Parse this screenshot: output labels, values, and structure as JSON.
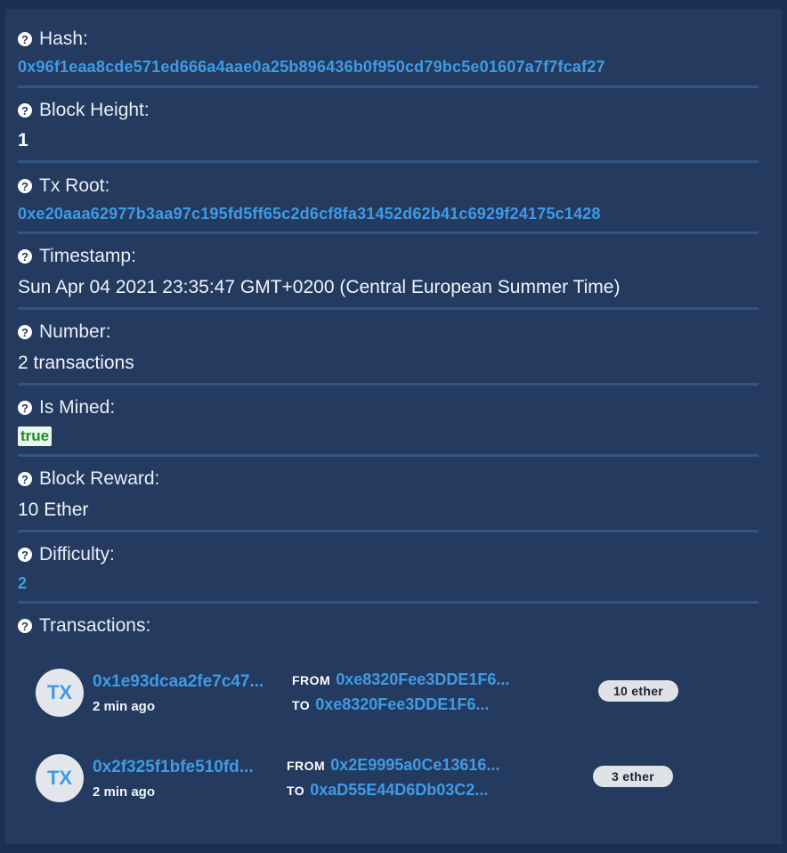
{
  "fields": {
    "hash": {
      "label": "Hash:",
      "value": "0x96f1eaa8cde571ed666a4aae0a25b896436b0f950cd79bc5e01607a7f7fcaf27"
    },
    "block_height": {
      "label": "Block Height:",
      "value": "1"
    },
    "tx_root": {
      "label": "Tx Root:",
      "value": "0xe20aaa62977b3aa97c195fd5ff65c2d6cf8fa31452d62b41c6929f24175c1428"
    },
    "timestamp": {
      "label": "Timestamp:",
      "value": "Sun Apr 04 2021 23:35:47 GMT+0200 (Central European Summer Time)"
    },
    "number": {
      "label": "Number:",
      "value": "2 transactions"
    },
    "is_mined": {
      "label": "Is Mined:",
      "value": "true"
    },
    "block_reward": {
      "label": "Block Reward:",
      "value": "10 Ether"
    },
    "difficulty": {
      "label": "Difficulty:",
      "value": "2"
    },
    "transactions": {
      "label": "Transactions:"
    }
  },
  "help_icon": "question-circle-icon",
  "transactions": [
    {
      "avatar": "TX",
      "hash": "0x1e93dcaa2fe7c47...",
      "time": "2 min ago",
      "from_label": "FROM",
      "from": "0xe8320Fee3DDE1F6...",
      "to_label": "TO",
      "to": "0xe8320Fee3DDE1F6...",
      "amount": "10 ether"
    },
    {
      "avatar": "TX",
      "hash": "0x2f325f1bfe510fd...",
      "time": "2 min ago",
      "from_label": "FROM",
      "from": "0x2E9995a0Ce13616...",
      "to_label": "TO",
      "to": "0xaD55E44D6Db03C2...",
      "amount": "3 ether"
    }
  ],
  "colors": {
    "background": "#1b2f52",
    "panel": "#243a5e",
    "link": "#3f9be6",
    "divider": "#345583",
    "true_badge_bg": "#e9f7ec",
    "true_badge_text": "#1f8a2d"
  }
}
